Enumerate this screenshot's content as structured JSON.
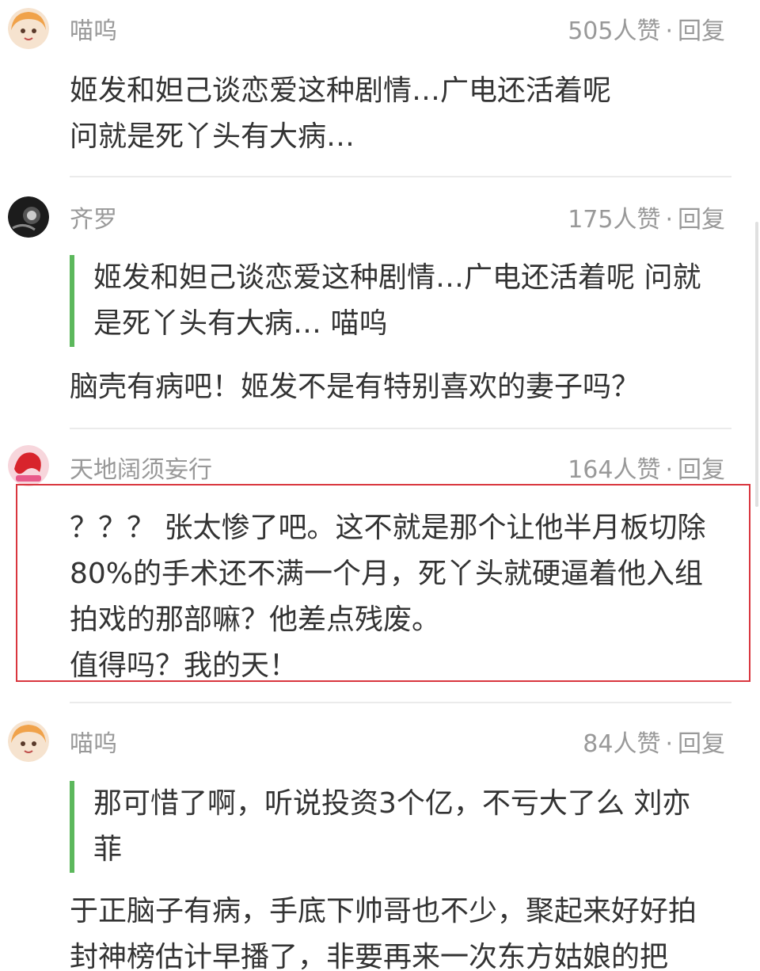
{
  "comments": [
    {
      "username": "喵呜",
      "likes": "505人赞",
      "dot": "·",
      "reply": "回复",
      "lines": [
        "姬发和妲己谈恋爱这种剧情…广电还活着呢",
        "问就是死丫头有大病…"
      ]
    },
    {
      "username": "齐罗",
      "likes": "175人赞",
      "dot": "·",
      "reply": "回复",
      "quote": [
        "姬发和妲己谈恋爱这种剧情…广电还活着呢 问就",
        "是死丫头有大病… 喵呜"
      ],
      "lines": [
        "脑壳有病吧！姬发不是有特别喜欢的妻子吗？"
      ]
    },
    {
      "username": "天地阔须妄行",
      "likes": "164人赞",
      "dot": "·",
      "reply": "回复",
      "lines": [
        "？？？ 张太惨了吧。这不就是那个让他半月板切除",
        "80%的手术还不满一个月，死丫头就硬逼着他入组",
        "拍戏的那部嘛？他差点残废。",
        "值得吗？我的天！"
      ]
    },
    {
      "username": "喵呜",
      "likes": "84人赞",
      "dot": "·",
      "reply": "回复",
      "quote": [
        "那可惜了啊，听说投资3个亿，不亏大了么 刘亦",
        "菲"
      ],
      "lines": [
        "于正脑子有病，手底下帅哥也不少，聚起来好好拍",
        "封神榜估计早播了，非要再来一次东方姑娘的把"
      ]
    }
  ],
  "colors": {
    "quote_bar": "#5cb85c",
    "highlight_border": "#d9363e",
    "meta_text": "#999999"
  }
}
